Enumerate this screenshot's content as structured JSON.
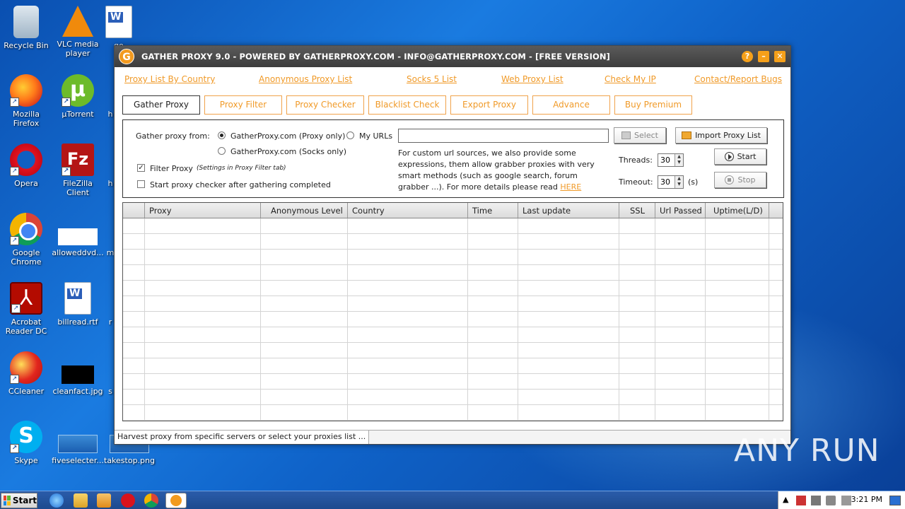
{
  "desktop": {
    "icons": [
      {
        "label": "Recycle Bin"
      },
      {
        "label": "VLC media player"
      },
      {
        "label": "go"
      },
      {
        "label": "Mozilla Firefox"
      },
      {
        "label": "µTorrent"
      },
      {
        "label": "h"
      },
      {
        "label": "Opera"
      },
      {
        "label": "FileZilla Client"
      },
      {
        "label": "h"
      },
      {
        "label": "Google Chrome"
      },
      {
        "label": "alloweddvd..."
      },
      {
        "label": "m"
      },
      {
        "label": "Acrobat Reader DC"
      },
      {
        "label": "billread.rtf"
      },
      {
        "label": "r"
      },
      {
        "label": "CCleaner"
      },
      {
        "label": "cleanfact.jpg"
      },
      {
        "label": "s"
      },
      {
        "label": "Skype"
      },
      {
        "label": "fiveselecter..."
      },
      {
        "label": "takestop.png"
      }
    ]
  },
  "window": {
    "title": "GATHER PROXY 9.0 - POWERED BY GATHERPROXY.COM - INFO@GATHERPROXY.COM - [FREE VERSION]",
    "logo_letter": "G",
    "help_symbol": "?",
    "minimize_symbol": "–",
    "close_symbol": "✕"
  },
  "nav_links": [
    "Proxy List By Country",
    "Anonymous Proxy List",
    "Socks 5 List",
    "Web Proxy List",
    "Check My IP",
    "Contact/Report Bugs"
  ],
  "tabs": [
    "Gather Proxy",
    "Proxy Filter",
    "Proxy Checker",
    "Blacklist Check",
    "Export Proxy",
    "Advance",
    "Buy Premium"
  ],
  "gather": {
    "from_label": "Gather proxy from:",
    "option_proxy": "GatherProxy.com (Proxy only)",
    "option_socks": "GatherProxy.com (Socks only)",
    "option_myurls": "My URLs",
    "url_value": "",
    "select_button": "Select",
    "import_button": "Import Proxy List",
    "filter_proxy_label": "Filter Proxy",
    "filter_proxy_checked": true,
    "filter_note": "(Settings in Proxy Filter tab)",
    "start_checker_label": "Start proxy checker after gathering completed",
    "start_checker_checked": false,
    "description": "For custom url sources, we also provide some expressions, them allow grabber proxies with very smart methods (such as google search, forum grabber ...). For more details please read",
    "here_link": "HERE",
    "threads_label": "Threads:",
    "threads_value": "30",
    "timeout_label": "Timeout:",
    "timeout_value": "30",
    "timeout_unit": "(s)",
    "start_button": "Start",
    "stop_button": "Stop"
  },
  "table": {
    "columns": [
      "",
      "Proxy",
      "Anonymous Level",
      "Country",
      "Time",
      "Last update",
      "SSL",
      "Url Passed",
      "Uptime(L/D)",
      ""
    ],
    "rows": 13
  },
  "status_text": "Harvest proxy from specific servers or select your proxies list ...",
  "watermark": "ANY RUN",
  "taskbar": {
    "start_label": "Start",
    "clock": "3:21 PM"
  },
  "colors": {
    "accent": "#f09a28",
    "titlebar": "#4a4a4a"
  }
}
